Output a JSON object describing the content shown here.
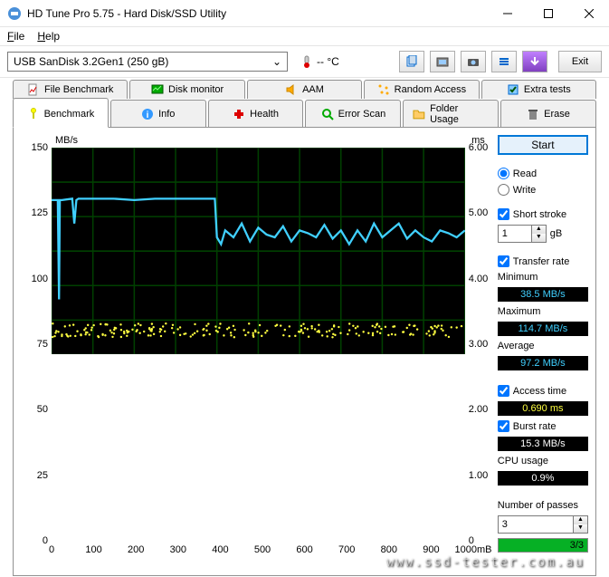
{
  "window": {
    "title": "HD Tune Pro 5.75 - Hard Disk/SSD Utility"
  },
  "menu": {
    "file": "File",
    "help": "Help"
  },
  "toolbar": {
    "drive": "USB SanDisk 3.2Gen1 (250 gB)",
    "temp": "-- °C",
    "exit": "Exit"
  },
  "tabs_top": {
    "file_benchmark": "File Benchmark",
    "disk_monitor": "Disk monitor",
    "aam": "AAM",
    "random_access": "Random Access",
    "extra_tests": "Extra tests"
  },
  "tabs_bottom": {
    "benchmark": "Benchmark",
    "info": "Info",
    "health": "Health",
    "error_scan": "Error Scan",
    "folder_usage": "Folder Usage",
    "erase": "Erase"
  },
  "side": {
    "start": "Start",
    "read": "Read",
    "write": "Write",
    "short_stroke": "Short stroke",
    "short_stroke_val": "1",
    "short_stroke_unit": "gB",
    "transfer_rate": "Transfer rate",
    "minimum": "Minimum",
    "minimum_val": "38.5 MB/s",
    "maximum": "Maximum",
    "maximum_val": "114.7 MB/s",
    "average": "Average",
    "average_val": "97.2 MB/s",
    "access_time": "Access time",
    "access_time_val": "0.690 ms",
    "burst_rate": "Burst rate",
    "burst_rate_val": "15.3 MB/s",
    "cpu_usage": "CPU usage",
    "cpu_usage_val": "0.9%",
    "passes": "Number of passes",
    "passes_val": "3",
    "progress_txt": "3/3"
  },
  "watermark": "www.ssd-tester.com.au",
  "chart_data": {
    "type": "line",
    "title": "",
    "xlabel": "mB",
    "ylabel_left": "MB/s",
    "ylabel_right": "ms",
    "xlim": [
      0,
      1000
    ],
    "ylim_left": [
      0,
      150
    ],
    "ylim_right": [
      0,
      6.0
    ],
    "xticks": [
      0,
      100,
      200,
      300,
      400,
      500,
      600,
      700,
      800,
      900,
      1000
    ],
    "yticks_left": [
      0,
      25,
      50,
      75,
      100,
      125,
      150
    ],
    "yticks_right": [
      "0",
      "1.00",
      "2.00",
      "3.00",
      "4.00",
      "5.00",
      "6.00"
    ],
    "series": [
      {
        "name": "Transfer rate (MB/s)",
        "axis": "left",
        "color": "#40d0ff",
        "x": [
          0,
          15,
          18,
          20,
          25,
          50,
          55,
          60,
          65,
          100,
          150,
          200,
          250,
          300,
          350,
          380,
          395,
          400,
          410,
          420,
          440,
          460,
          480,
          500,
          520,
          540,
          560,
          580,
          600,
          620,
          640,
          660,
          680,
          700,
          720,
          740,
          760,
          780,
          800,
          820,
          840,
          860,
          880,
          900,
          920,
          940,
          960,
          980,
          1000
        ],
        "y": [
          112,
          112,
          40,
          112,
          112,
          113,
          95,
          112,
          113,
          113,
          113,
          112,
          113,
          113,
          113,
          113,
          113,
          85,
          80,
          90,
          85,
          95,
          82,
          92,
          87,
          85,
          93,
          82,
          90,
          88,
          85,
          94,
          84,
          90,
          80,
          90,
          82,
          95,
          85,
          90,
          95,
          84,
          90,
          85,
          82,
          90,
          88,
          85,
          90
        ]
      },
      {
        "name": "Access time (ms)",
        "axis": "right",
        "color": "#ffff40",
        "scatter": true,
        "y_range": [
          0.5,
          0.9
        ],
        "count": 220
      }
    ]
  }
}
